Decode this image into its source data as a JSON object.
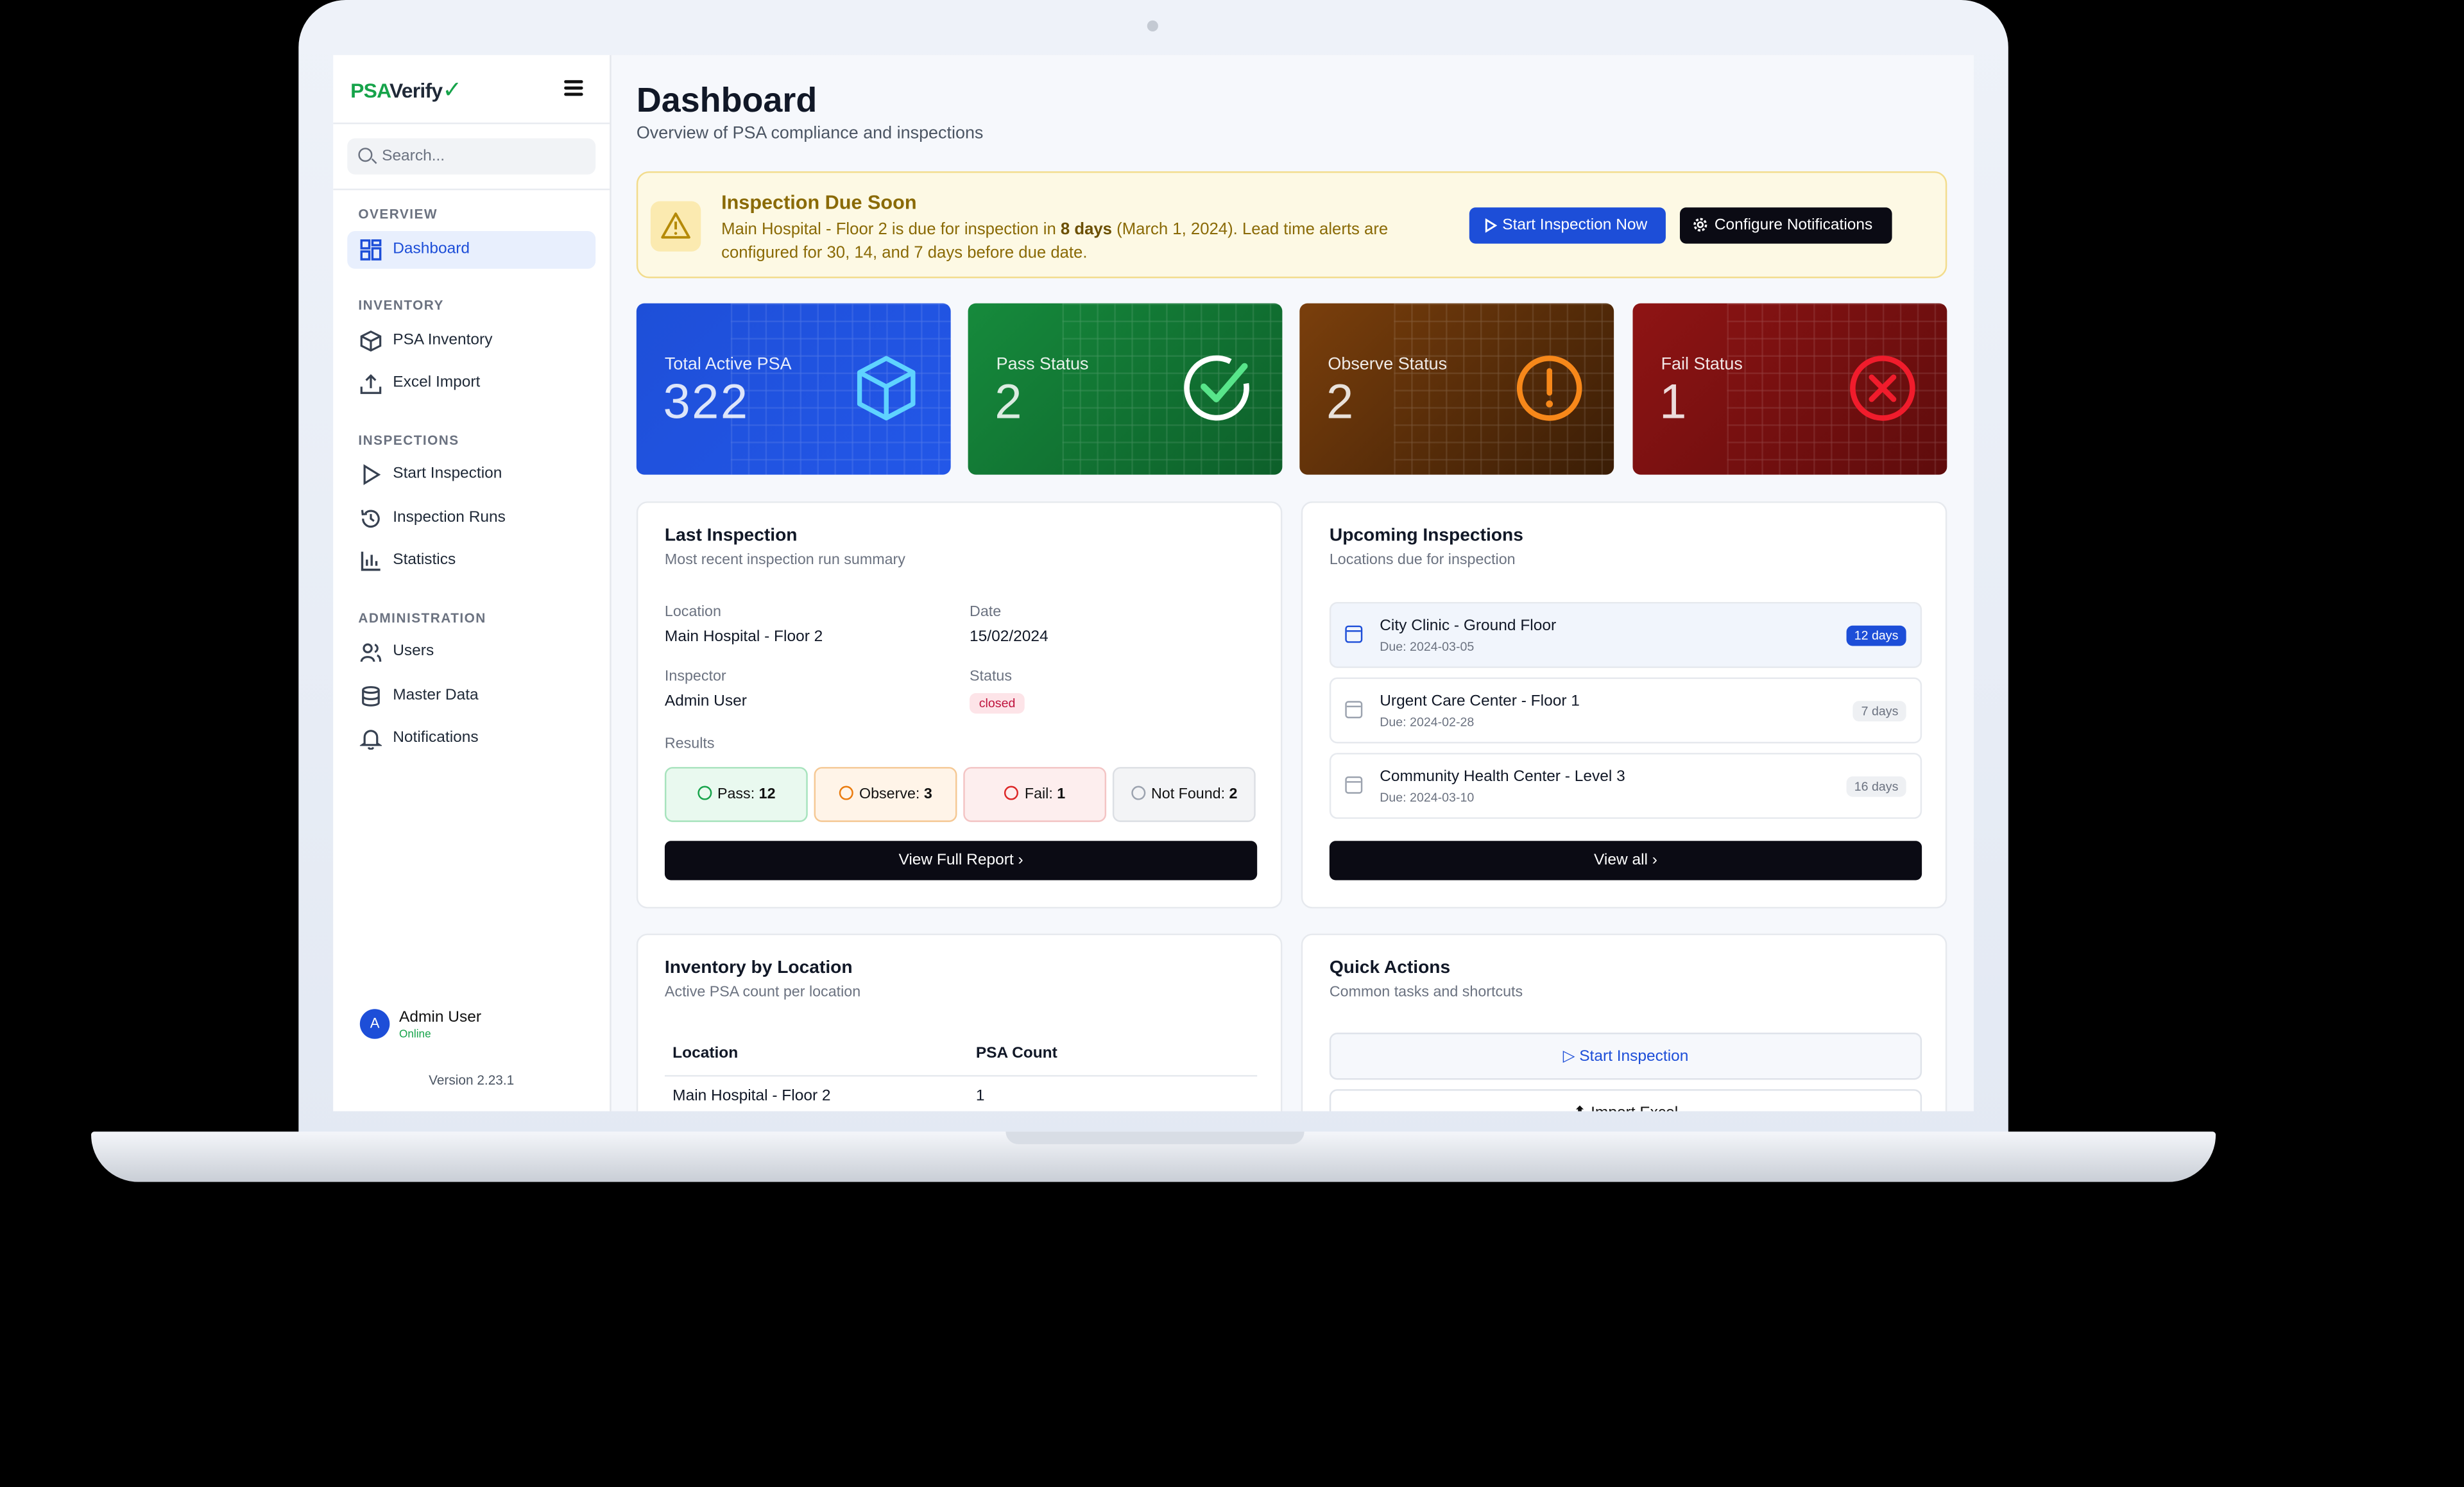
{
  "app": {
    "logo_psa": "PSA",
    "logo_verify": "Verify",
    "search_placeholder": "Search..."
  },
  "sidebar": {
    "sections": [
      {
        "title": "OVERVIEW",
        "items": [
          {
            "label": "Dashboard",
            "icon": "dashboard-icon",
            "active": true
          }
        ]
      },
      {
        "title": "INVENTORY",
        "items": [
          {
            "label": "PSA Inventory",
            "icon": "box-icon"
          },
          {
            "label": "Excel Import",
            "icon": "upload-icon"
          }
        ]
      },
      {
        "title": "INSPECTIONS",
        "items": [
          {
            "label": "Start Inspection",
            "icon": "play-icon"
          },
          {
            "label": "Inspection Runs",
            "icon": "history-icon"
          },
          {
            "label": "Statistics",
            "icon": "bar-chart-icon"
          }
        ]
      },
      {
        "title": "ADMINISTRATION",
        "items": [
          {
            "label": "Users",
            "icon": "users-icon"
          },
          {
            "label": "Master Data",
            "icon": "database-icon"
          },
          {
            "label": "Notifications",
            "icon": "bell-icon"
          }
        ]
      }
    ],
    "user": {
      "initial": "A",
      "name": "Admin User",
      "status": "Online"
    },
    "version": "Version 2.23.1"
  },
  "page": {
    "title": "Dashboard",
    "subtitle": "Overview of PSA compliance and inspections"
  },
  "alert": {
    "title": "Inspection Due Soon",
    "text_1": "Main Hospital - Floor 2 is due for inspection in ",
    "text_bold": "8 days",
    "text_2": " (March 1, 2024). Lead time alerts are configured for 30, 14, and 7 days before due date.",
    "primary_button": "Start Inspection Now",
    "secondary_button": "Configure Notifications"
  },
  "stats": [
    {
      "label": "Total Active PSA",
      "value": "322",
      "icon": "cube-icon",
      "color": "#1d4ed8"
    },
    {
      "label": "Pass Status",
      "value": "2",
      "icon": "check-circle-icon",
      "color": "#15803d"
    },
    {
      "label": "Observe Status",
      "value": "2",
      "icon": "warning-circle-icon",
      "color": "#7c3a0a"
    },
    {
      "label": "Fail Status",
      "value": "1",
      "icon": "x-circle-icon",
      "color": "#8f1414"
    }
  ],
  "last_inspection": {
    "title": "Last Inspection",
    "subtitle": "Most recent inspection run summary",
    "location_label": "Location",
    "location": "Main Hospital - Floor 2",
    "date_label": "Date",
    "date": "15/02/2024",
    "inspector_label": "Inspector",
    "inspector": "Admin User",
    "status_label": "Status",
    "status": "closed",
    "results_label": "Results",
    "results": [
      {
        "label": "Pass: ",
        "count": "12"
      },
      {
        "label": "Observe: ",
        "count": "3"
      },
      {
        "label": "Fail: ",
        "count": "1"
      },
      {
        "label": "Not Found: ",
        "count": "2"
      }
    ],
    "button": "View Full Report"
  },
  "upcoming": {
    "title": "Upcoming Inspections",
    "subtitle": "Locations due for inspection",
    "items": [
      {
        "name": "City Clinic - Ground Floor",
        "due": "Due: 2024-03-05",
        "days": "12 days"
      },
      {
        "name": "Urgent Care Center - Floor 1",
        "due": "Due: 2024-02-28",
        "days": "7 days"
      },
      {
        "name": "Community Health Center - Level 3",
        "due": "Due: 2024-03-10",
        "days": "16 days"
      }
    ],
    "button": "View all"
  },
  "inventory": {
    "title": "Inventory by Location",
    "subtitle": "Active PSA count per location",
    "columns": [
      "Location",
      "PSA Count"
    ],
    "rows": [
      [
        "Main Hospital - Floor 2",
        "1"
      ]
    ]
  },
  "quick_actions": {
    "title": "Quick Actions",
    "subtitle": "Common tasks and shortcuts",
    "items": [
      "Start Inspection",
      "Import Excel"
    ]
  }
}
